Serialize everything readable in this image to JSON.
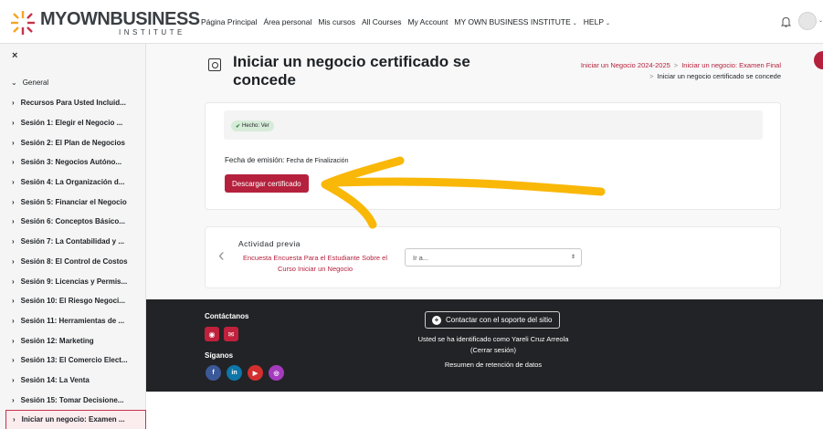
{
  "brand": {
    "name": "MYOWNBUSINESS",
    "sub": "INSTITUTE",
    "colors": {
      "primary": "#b5213c",
      "logo_orange": "#f5a623",
      "logo_red": "#c7324b"
    }
  },
  "nav": {
    "items": [
      {
        "label": "Página Principal"
      },
      {
        "label": "Área personal"
      },
      {
        "label": "Mis cursos"
      },
      {
        "label": "All Courses"
      },
      {
        "label": "My Account"
      },
      {
        "label": "MY OWN BUSINESS INSTITUTE",
        "dropdown": true
      },
      {
        "label": "HELP",
        "dropdown": true
      }
    ],
    "caret": "⌄",
    "bell_icon": "bell-icon",
    "avatar_icon": "user-avatar"
  },
  "sidebar": {
    "close": "×",
    "general": "General",
    "chev_down": "⌄",
    "chev_right": "›",
    "items": [
      {
        "label": "Recursos Para Usted Incluid..."
      },
      {
        "label": "Sesión 1: Elegir el Negocio ..."
      },
      {
        "label": "Sesión 2: El Plan de Negocios"
      },
      {
        "label": "Sesión 3: Negocios Autóno..."
      },
      {
        "label": "Sesión 4: La Organización d..."
      },
      {
        "label": "Sesión 5: Financiar el Negocio"
      },
      {
        "label": "Sesión 6: Conceptos Básico..."
      },
      {
        "label": "Sesión 7: La Contabilidad y ..."
      },
      {
        "label": "Sesión 8: El Control de Costos"
      },
      {
        "label": "Sesión 9: Licencias y Permis..."
      },
      {
        "label": "Sesión 10: El Riesgo Negoci..."
      },
      {
        "label": "Sesión 11: Herramientas de ..."
      },
      {
        "label": "Sesión 12: Marketing"
      },
      {
        "label": "Sesión 13: El Comercio Elect..."
      },
      {
        "label": "Sesión 14: La Venta"
      },
      {
        "label": "Sesión 15: Tomar Decisione..."
      },
      {
        "label": "Iniciar un negocio: Examen ...",
        "active": true
      }
    ]
  },
  "main": {
    "title": "Iniciar un negocio certificado se concede",
    "breadcrumb": {
      "link1": "Iniciar un Negocio 2024-2025",
      "link2": "Iniciar un negocio: Examen Final",
      "current": "Iniciar un negocio certificado se concede",
      "sep": ">"
    },
    "completion": {
      "tick": "✔",
      "label": "Hecho: Ver"
    },
    "issue_date": {
      "label": "Fecha de emisión:",
      "value": "Fecha de Finalización"
    },
    "download_label": "Descargar certificado",
    "previous": {
      "chevron": "‹",
      "label": "Actividad previa",
      "link": "Encuesta Encuesta Para el Estudiante Sobre el Curso Iniciar un Negocio"
    },
    "jump_to": {
      "value": "Ir a...",
      "updown": "⇕"
    }
  },
  "footer": {
    "contact_heading": "Contáctanos",
    "follow_heading": "Síganos",
    "contact_icons": [
      {
        "icon": "globe-icon",
        "glyph": "◉",
        "color": "#c0213c"
      },
      {
        "icon": "envelope-icon",
        "glyph": "✉",
        "color": "#c0213c"
      }
    ],
    "social": [
      {
        "icon": "facebook-icon",
        "glyph": "f",
        "color": "#3b5998"
      },
      {
        "icon": "linkedin-icon",
        "glyph": "in",
        "color": "#0e76a8"
      },
      {
        "icon": "youtube-icon",
        "glyph": "▶",
        "color": "#d32f2f"
      },
      {
        "icon": "instagram-icon",
        "glyph": "◎",
        "color": "#a43bbd"
      }
    ],
    "support_icon": "+",
    "support_label": "Contactar con el soporte del sitio",
    "logged_in": "Usted se ha identificado como Yareli Cruz Arreola",
    "logout": "(Cerrar sesión)",
    "retention": "Resumen de retención de datos"
  },
  "annotation": {
    "color": "#f9b708"
  }
}
